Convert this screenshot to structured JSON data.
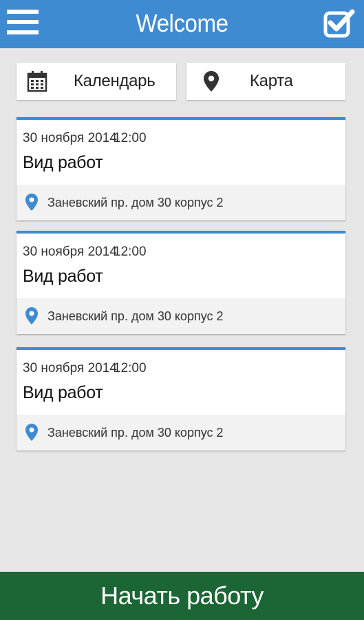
{
  "colors": {
    "header": "#3f8bd2",
    "accent": "#3f8bd2",
    "background": "#e6e6e6",
    "start_button": "#1b6634"
  },
  "header": {
    "title": "Welcome",
    "menu_icon": "hamburger-menu-icon",
    "right_icon": "checkbox-check-icon"
  },
  "nav": {
    "calendar": {
      "label": "Календарь",
      "icon": "calendar-icon"
    },
    "map": {
      "label": "Карта",
      "icon": "map-pin-icon"
    }
  },
  "events": [
    {
      "date": "30 ноября 2014",
      "time": "12:00",
      "work": "Вид работ",
      "address": "Заневский пр. дом 30 корпус 2"
    },
    {
      "date": "30 ноября 2014",
      "time": "12:00",
      "work": "Вид работ",
      "address": "Заневский пр. дом 30 корпус 2"
    },
    {
      "date": "30 ноября 2014",
      "time": "12:00",
      "work": "Вид работ",
      "address": "Заневский пр. дом 30 корпус 2"
    }
  ],
  "footer": {
    "start_label": "Начать работу"
  }
}
